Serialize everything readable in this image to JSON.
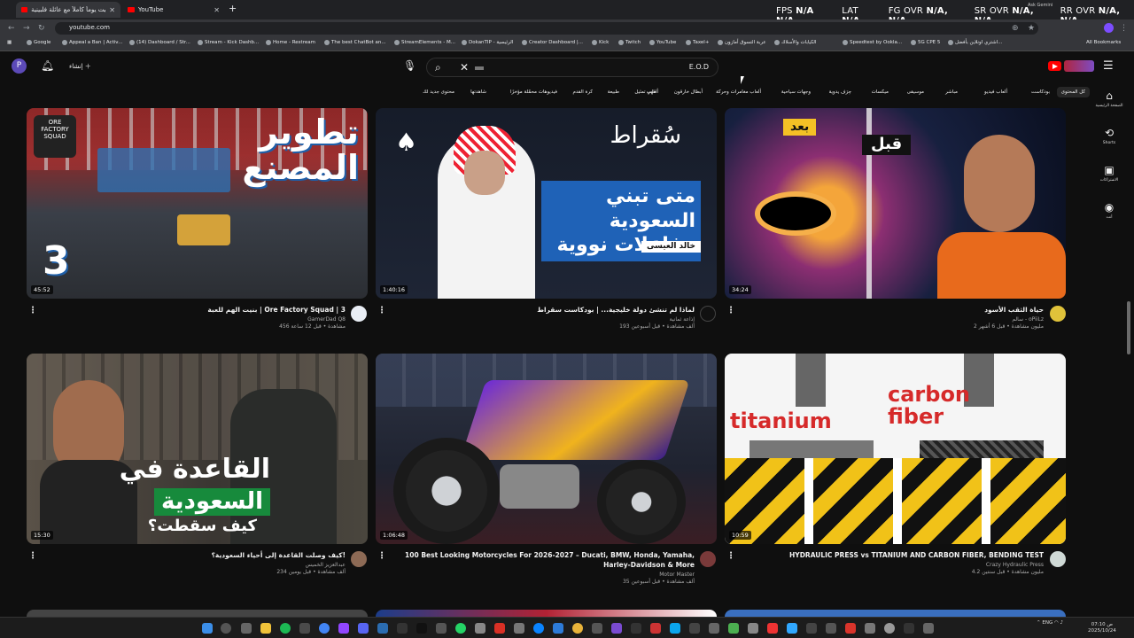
{
  "browser": {
    "tabs": [
      {
        "label": "قضيت يوماً كاملاً مع عائلة فلبينية"
      },
      {
        "label": "YouTube"
      }
    ],
    "url": "youtube.com",
    "bookmarks": [
      "Google",
      "Appeal a Ban | Activ...",
      "(14) Dashboard / Str...",
      "Stream - Kick Dashb...",
      "Home - Restream",
      "The best ChatBot an...",
      "StreamElements - M...",
      "DokanTIP - الرئيسية",
      "Creator Dashboard |...",
      "Kick",
      "Twitch",
      "YouTube",
      "Taxel+",
      "عربة التسوق أمازون",
      "الكيابات والأسلاك",
      "Speedtest by Ookla...",
      "5G CPE 5",
      "اشتري اونلاين بأفضل...",
      "All Bookmarks"
    ]
  },
  "overlay": {
    "fps": {
      "label": "FPS",
      "v1": "N/A",
      "v2": "N/A"
    },
    "lat": {
      "label": "LAT",
      "v": "N/A"
    },
    "fg": {
      "label": "FG OVR",
      "v": "N/A, N/A"
    },
    "sr": {
      "label": "SR OVR",
      "v": "N/A, N/A"
    },
    "rr": {
      "label": "RR OVR",
      "v": "N/A, N/A"
    },
    "gemini_label": "Ask Gemini"
  },
  "header": {
    "avatar_letter": "P",
    "create_label": "إنشاء",
    "search_text": "E.O.D"
  },
  "chips": [
    "كل المحتوى",
    "بودكاست",
    "ألعاب فيديو",
    "مباشر",
    "موسيقى",
    "ميكسات",
    "حِرَف يدوية",
    "وجهات سياحية",
    "ألعاب مغامرات وحركة",
    "أبطال خارقون",
    "ألعاب تمثيل",
    "طبيعة",
    "طهي",
    "كرة القدم",
    "فيديوهات محمّلة مؤخرًا",
    "شاهدتها",
    "محتوى جديد لك"
  ],
  "rail": [
    {
      "icon": "home-icon",
      "label": "الصفحة الرئيسية"
    },
    {
      "icon": "shorts-icon",
      "label": "Shorts"
    },
    {
      "icon": "subscriptions-icon",
      "label": "الاشتراكات"
    },
    {
      "icon": "you-icon",
      "label": "أنت"
    }
  ],
  "videos": [
    {
      "title": "بنيت الهم للعبة | Ore Factory Squad | 3",
      "channel": "GamerDad Q8",
      "stats": "456 مشاهدة • قبل 12 ساعة",
      "duration": "45:52",
      "thumb_heading": "تطوير المصنع",
      "thumb_badge": "ORE FACTORY SQUAD",
      "thumb_number": "3"
    },
    {
      "title": "لماذا لم تنشئ دولة خليجية... | بودكاست سقراط",
      "channel": "إذاعة ثمانية",
      "stats": "193 ألف مشاهدة • قبل أسبوعين",
      "duration": "1:40:16",
      "thumb_heading": "متى تبني السعودية مفاعلات نووية",
      "thumb_brand": "سُقراط",
      "thumb_name": "خالد العيسى"
    },
    {
      "title": "حياة الثقب الأسود",
      "channel": "سالم - oPiiLz",
      "stats": "2 مليون مشاهدة • قبل 6 أشهر",
      "duration": "34:24",
      "thumb_before": "قبل",
      "thumb_after": "بعد"
    },
    {
      "title": "كيف وصلت القاعدة إلى أحياء السعودية؟!",
      "channel": "عبدالعزيز الخميس",
      "stats": "234 ألف مشاهدة • قبل يومين",
      "duration": "15:30",
      "thumb_heading": "القاعدة في السعودية",
      "thumb_sub": "كيف سقطت؟"
    },
    {
      "title": "100 Best Looking Motorcycles For 2026-2027 – Ducati, BMW, Honda, Yamaha, Harley-Davidson & More",
      "channel": "Motor Master",
      "stats": "35 ألف مشاهدة • قبل أسبوعين",
      "duration": "1:06:48"
    },
    {
      "title": "HYDRAULIC PRESS vs TITANIUM AND CARBON FIBER, BENDING TEST",
      "channel": "Crazy Hydraulic Press",
      "stats": "4.2 مليون مشاهدة • قبل سنتين",
      "duration": "10:59",
      "thumb_left": "titanium",
      "thumb_right": "carbon fiber"
    }
  ],
  "taskbar": {
    "lang": "ENG",
    "time": "07:10 ص",
    "date": "2025/10/24"
  }
}
